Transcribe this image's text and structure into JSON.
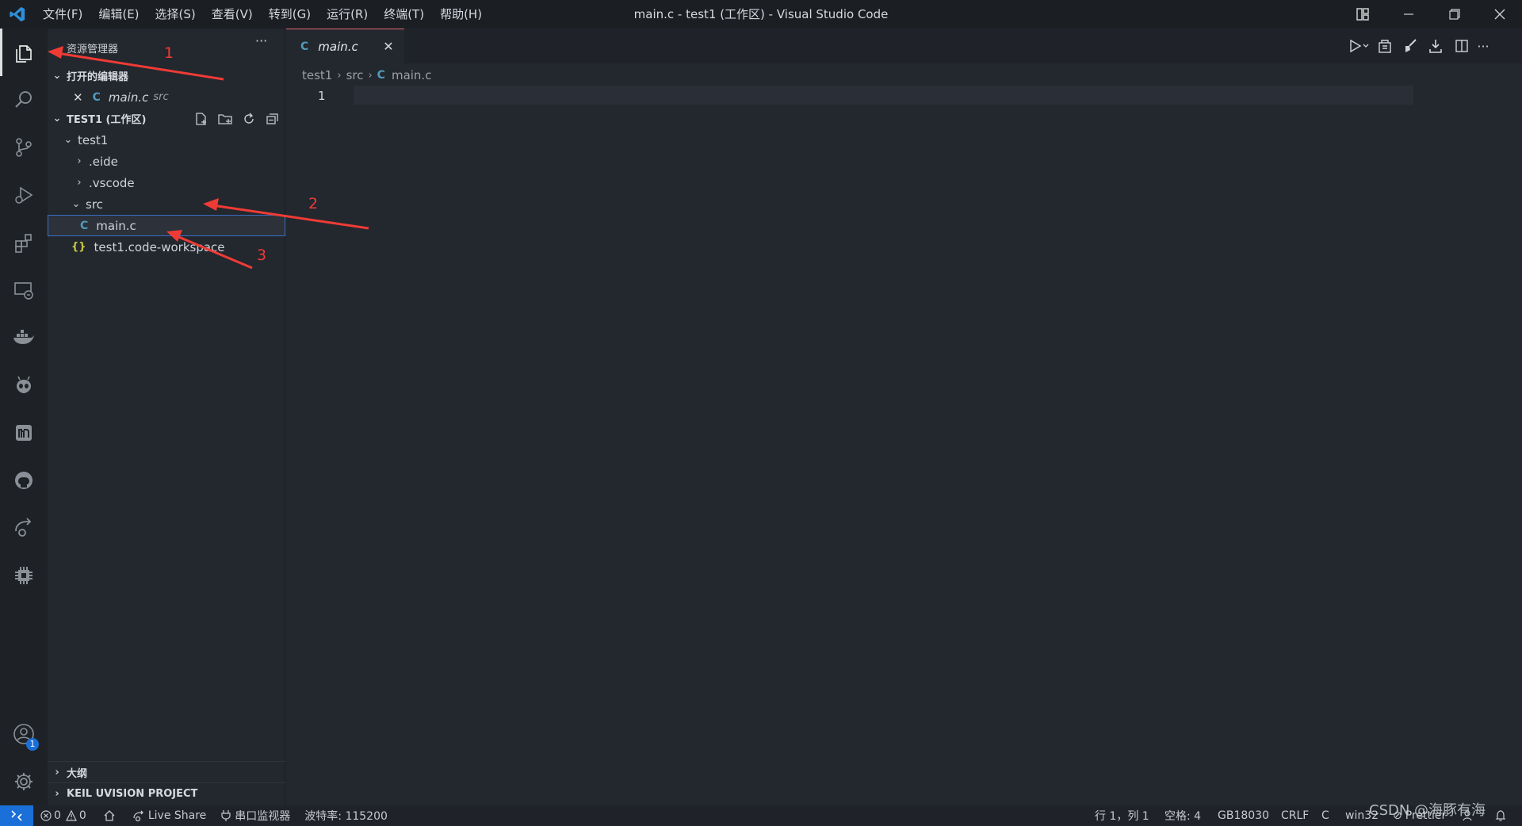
{
  "titlebar": {
    "menus": [
      "文件(F)",
      "编辑(E)",
      "选择(S)",
      "查看(V)",
      "转到(G)",
      "运行(R)",
      "终端(T)",
      "帮助(H)"
    ],
    "title": "main.c - test1 (工作区) - Visual Studio Code"
  },
  "activitybar": {
    "icons": [
      "explorer-icon",
      "search-icon",
      "source-control-icon",
      "run-debug-icon",
      "extensions-icon",
      "remote-explorer-icon",
      "docker-icon",
      "alien-icon",
      "m-icon",
      "github-icon",
      "live-share-icon",
      "chip-icon",
      "accounts-icon",
      "settings-gear-icon"
    ],
    "accounts_badge": "1"
  },
  "sidebar": {
    "title": "资源管理器",
    "more": "···",
    "open_editors_header": "打开的编辑器",
    "open_editor": {
      "close": "✕",
      "icon": "C",
      "name": "main.c",
      "folder": "src"
    },
    "workspace_header": "TEST1 (工作区)",
    "tree": {
      "root": "test1",
      "eide": ".eide",
      "vscode": ".vscode",
      "src": "src",
      "main": "main.c",
      "workspace_file": "test1.code-workspace"
    },
    "outline_header": "大纲",
    "keil_header": "KEIL UVISION PROJECT"
  },
  "editor": {
    "tab": {
      "icon": "C",
      "label": "main.c",
      "close": "✕"
    },
    "breadcrumb": [
      "test1",
      "src",
      "main.c"
    ],
    "line_number": "1"
  },
  "statusbar": {
    "errors": "0",
    "warnings": "0",
    "live_share": "Live Share",
    "serial_monitor": "串口监视器",
    "baud_rate": "波特率: 115200",
    "position": "行 1，列 1",
    "spaces": "空格: 4",
    "encoding": "GB18030",
    "eol": "CRLF",
    "language": "C",
    "platform": "win32",
    "prettier": "Prettier"
  },
  "annotations": {
    "n1": "1",
    "n2": "2",
    "n3": "3"
  },
  "watermark": "CSDN @海豚有海",
  "colors": {
    "arrow": "#ef3b36",
    "remote": "#1a6fd8",
    "c_icon": "#519aba",
    "selection_border": "#3a6fc4"
  }
}
